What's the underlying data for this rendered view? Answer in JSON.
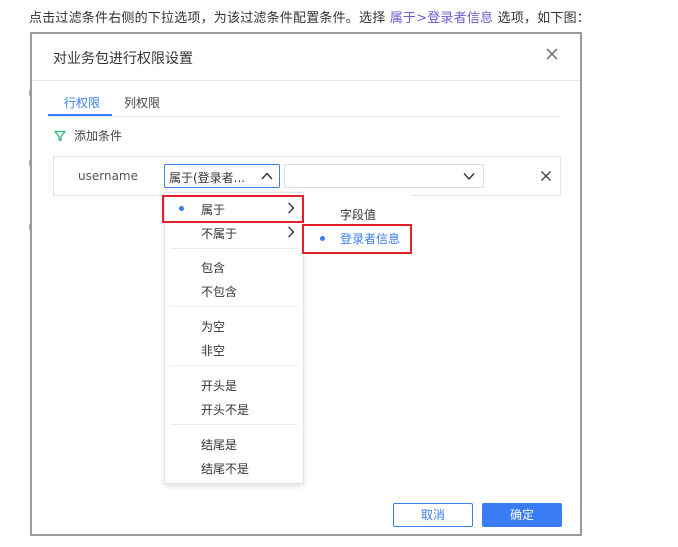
{
  "doc": {
    "text_before": "点击过滤条件右侧的下拉选项，为该过滤条件配置条件。选择 ",
    "highlight": "属于>登录者信息",
    "text_after": " 选项，如下图："
  },
  "dialog": {
    "title": "对业务包进行权限设置",
    "tabs": {
      "row": "行权限",
      "col": "列权限"
    },
    "add_condition": "添加条件",
    "condition": {
      "field": "username",
      "operator_value": "属于(登录者...",
      "value_placeholder": ""
    },
    "menu": {
      "items": [
        {
          "label": "属于",
          "has_submenu": true,
          "selected": true
        },
        {
          "label": "不属于",
          "has_submenu": true,
          "selected": false
        },
        {
          "label": "包含"
        },
        {
          "label": "不包含"
        },
        {
          "label": "为空"
        },
        {
          "label": "非空"
        },
        {
          "label": "开头是"
        },
        {
          "label": "开头不是"
        },
        {
          "label": "结尾是"
        },
        {
          "label": "结尾不是"
        }
      ]
    },
    "submenu": {
      "items": [
        {
          "label": "字段值",
          "selected": false
        },
        {
          "label": "登录者信息",
          "selected": true
        }
      ]
    },
    "buttons": {
      "cancel": "取消",
      "ok": "确定"
    }
  },
  "colors": {
    "accent": "#3a7cf5",
    "highlight_box": "#e0202a",
    "doc_highlight": "#6a5fd1",
    "filter_icon": "#2bb673"
  }
}
